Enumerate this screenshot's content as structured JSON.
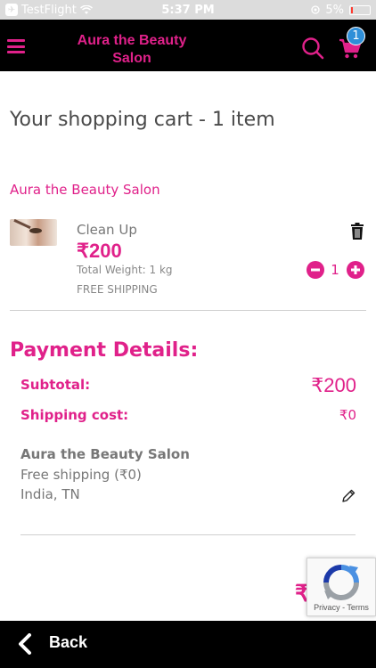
{
  "status_bar": {
    "app": "TestFlight",
    "time": "5:37 PM",
    "battery": "5%"
  },
  "header": {
    "brand_line1": "Aura the Beauty",
    "brand_line2": "Salon",
    "cart_count": "1",
    "accent_color": "#e0218a"
  },
  "cart": {
    "title": "Your shopping cart - 1 item",
    "store_name": "Aura the Beauty Salon",
    "item": {
      "name": "Clean Up",
      "price": "₹200",
      "weight": "Total Weight: 1 kg",
      "shipping": "FREE SHIPPING",
      "quantity": "1"
    }
  },
  "payment": {
    "title": "Payment Details:",
    "subtotal_label": "Subtotal:",
    "subtotal_value": "₹200",
    "shipping_label": "Shipping cost:",
    "shipping_value": "₹0",
    "address_name": "Aura the Beauty Salon",
    "address_shipping": "Free shipping (₹0)",
    "address_location": "India, TN",
    "total_partial": "₹"
  },
  "recaptcha": {
    "privacy": "Privacy",
    "separator": " - ",
    "terms": "Terms"
  },
  "footer": {
    "back_label": "Back"
  }
}
